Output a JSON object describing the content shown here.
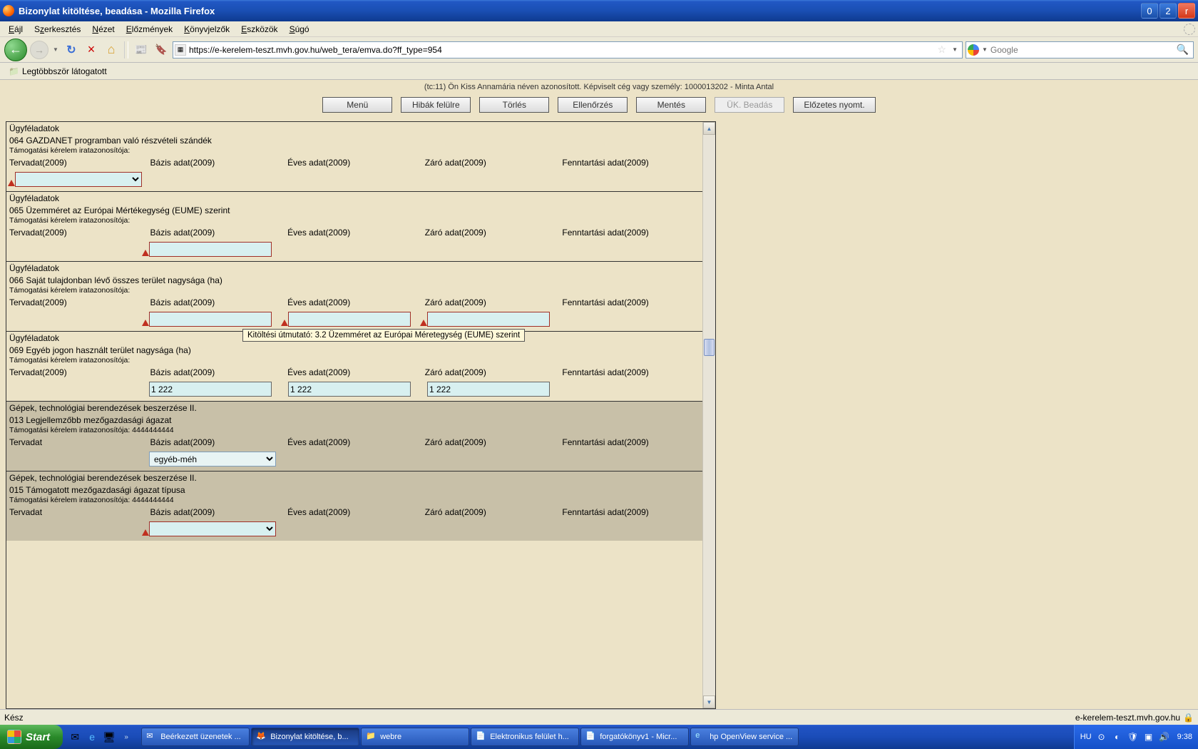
{
  "window": {
    "title": "Bizonylat kitöltése, beadása - Mozilla Firefox"
  },
  "menubar": [
    "Eájl",
    "Szerkesztés",
    "Nézet",
    "Előzmények",
    "Könyvjelzők",
    "Eszközök",
    "Súgó"
  ],
  "url": "https://e-kerelem-teszt.mvh.gov.hu/web_tera/emva.do?ff_type=954",
  "search": {
    "placeholder": "Google"
  },
  "bookmark_bar": {
    "most_visited": "Legtöbbször látogatott"
  },
  "page": {
    "status": "(tc:11) Ön Kiss Annamária néven azonosított.  Képviselt cég vagy személy: 1000013202 - Minta Antal",
    "buttons": {
      "menu": "Menü",
      "errors_up": "Hibák felülre",
      "delete": "Törlés",
      "check": "Ellenőrzés",
      "save": "Mentés",
      "submit": "ÜK. Beadás",
      "preview": "Előzetes nyomt."
    },
    "col_labels": {
      "terv": "Tervadat(2009)",
      "terv_short": "Tervadat",
      "bazis": "Bázis adat(2009)",
      "eves": "Éves adat(2009)",
      "zaro": "Záró adat(2009)",
      "fenntart": "Fenntartási adat(2009)"
    },
    "sections": [
      {
        "head": "Ügyféladatok",
        "title": "064  GAZDANET programban való részvételi szándék",
        "sub": "Támogatási kérelem iratazonosítója:",
        "inputs": {
          "terv_select": ""
        }
      },
      {
        "head": "Ügyféladatok",
        "title": "065  Üzemméret az Európai Mértékegység (EUME) szerint",
        "sub": "Támogatási kérelem iratazonosítója:",
        "inputs": {
          "bazis": ""
        }
      },
      {
        "head": "Ügyféladatok",
        "title": "066  Saját tulajdonban lévő összes terület nagysága  (ha)",
        "sub": "Támogatási kérelem iratazonosítója:",
        "inputs": {
          "bazis": "",
          "eves": "",
          "zaro": ""
        }
      },
      {
        "head": "Ügyféladatok",
        "title": "069  Egyéb jogon használt terület nagysága (ha)",
        "sub": "Támogatási kérelem iratazonosítója:",
        "inputs": {
          "bazis": "1 222",
          "eves": "1 222",
          "zaro": "1 222"
        }
      },
      {
        "head": "Gépek, technológiai berendezések beszerzése II.",
        "title": "013  Legjellemzőbb mezőgazdasági ágazat",
        "sub": "Támogatási kérelem iratazonosítója: 4444444444",
        "inputs": {
          "bazis_select": "egyéb-méh"
        }
      },
      {
        "head": "Gépek, technológiai berendezések beszerzése II.",
        "title": "015  Támogatott mezőgazdasági ágazat típusa",
        "sub": "Támogatási kérelem iratazonosítója: 4444444444",
        "inputs": {
          "bazis_select": ""
        }
      }
    ],
    "tooltip": "Kitöltési útmutató: 3.2 Üzemméret az Európai Méretegység (EUME) szerint"
  },
  "statusbar": {
    "left": "Kész",
    "right": "e-kerelem-teszt.mvh.gov.hu"
  },
  "taskbar": {
    "start": "Start",
    "tasks": [
      "Beérkezett üzenetek ...",
      "Bizonylat kitöltése, b...",
      "webre",
      "Elektronikus felület h...",
      "forgatókönyv1 - Micr...",
      "hp OpenView service ..."
    ],
    "lang": "HU",
    "clock": "9:38"
  }
}
